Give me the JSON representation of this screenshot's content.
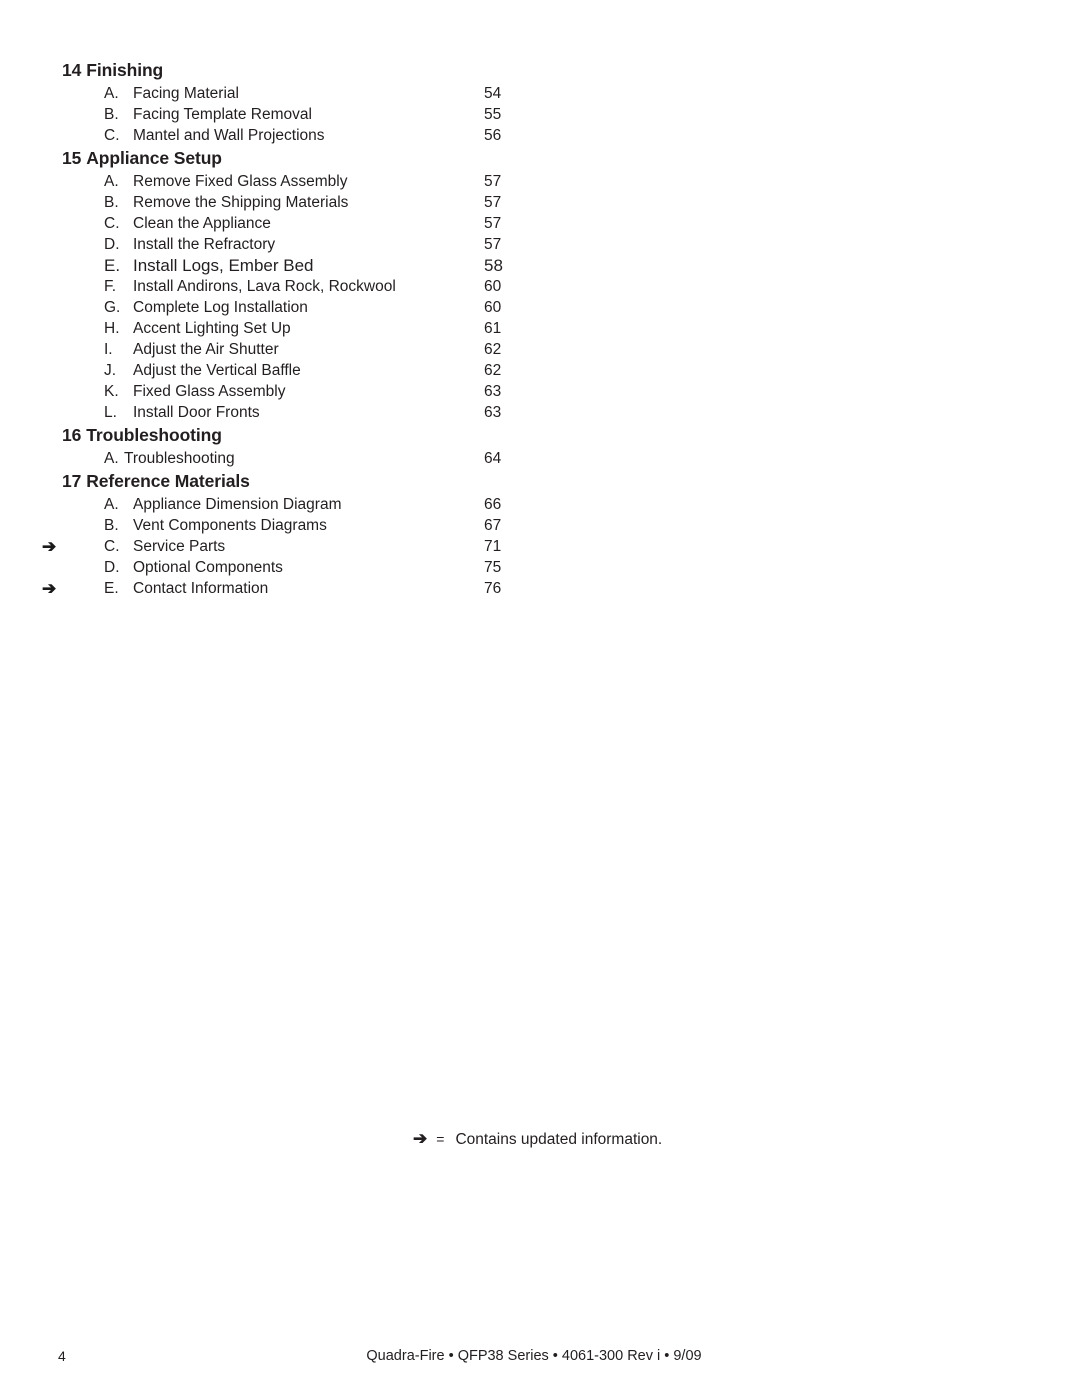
{
  "document": {
    "type": "table-of-contents",
    "page_number": "4",
    "footer_text": "Quadra-Fire • QFP38 Series • 4061-300 Rev i •  9/09"
  },
  "footnote": {
    "arrow": "➔",
    "equals": "=",
    "text": "Contains updated information."
  },
  "sections": [
    {
      "number": "14",
      "title": "Finishing",
      "entries": [
        {
          "marker": "",
          "letter": "A.",
          "title": "Facing Material",
          "page": "54"
        },
        {
          "marker": "",
          "letter": "B.",
          "title": "Facing Template Removal",
          "page": "55"
        },
        {
          "marker": "",
          "letter": "C.",
          "title": "Mantel and Wall Projections",
          "page": "56"
        }
      ]
    },
    {
      "number": "15",
      "title": "Appliance Setup",
      "entries": [
        {
          "marker": "",
          "letter": "A.",
          "title": "Remove Fixed Glass Assembly",
          "page": "57"
        },
        {
          "marker": "",
          "letter": "B.",
          "title": "Remove the Shipping Materials",
          "page": "57"
        },
        {
          "marker": "",
          "letter": "C.",
          "title": "Clean the Appliance",
          "page": "57"
        },
        {
          "marker": "",
          "letter": "D.",
          "title": "Install the Refractory",
          "page": "57"
        },
        {
          "marker": "",
          "letter": "E.",
          "title": "Install Logs, Ember Bed",
          "page": "58",
          "emphasis": true
        },
        {
          "marker": "",
          "letter": "F.",
          "title": "Install Andirons, Lava Rock, Rockwool",
          "page": "60"
        },
        {
          "marker": "",
          "letter": "G.",
          "title": "Complete Log Installation",
          "page": "60"
        },
        {
          "marker": "",
          "letter": "H.",
          "title": "Accent Lighting Set Up",
          "page": "61"
        },
        {
          "marker": "",
          "letter": "I.",
          "title": "Adjust the Air Shutter",
          "page": "62"
        },
        {
          "marker": "",
          "letter": "J.",
          "title": "Adjust the Vertical Baffle",
          "page": "62"
        },
        {
          "marker": "",
          "letter": "K.",
          "title": "Fixed Glass Assembly",
          "page": "63"
        },
        {
          "marker": "",
          "letter": "L.",
          "title": "Install Door Fronts",
          "page": "63"
        }
      ]
    },
    {
      "number": "16",
      "title": "Troubleshooting",
      "entries": [
        {
          "marker": "",
          "letter": "A.",
          "title": "Troubleshooting",
          "page": "64",
          "tight": true
        }
      ]
    },
    {
      "number": "17",
      "title": "Reference Materials",
      "entries": [
        {
          "marker": "",
          "letter": "A.",
          "title": "Appliance Dimension Diagram",
          "page": "66"
        },
        {
          "marker": "",
          "letter": "B.",
          "title": "Vent Components Diagrams",
          "page": "67"
        },
        {
          "marker": "➔",
          "letter": "C.",
          "title": "Service Parts",
          "page": "71"
        },
        {
          "marker": "",
          "letter": "D.",
          "title": "Optional Components",
          "page": "75"
        },
        {
          "marker": "➔",
          "letter": "E.",
          "title": "Contact Information",
          "page": "76"
        }
      ]
    }
  ]
}
